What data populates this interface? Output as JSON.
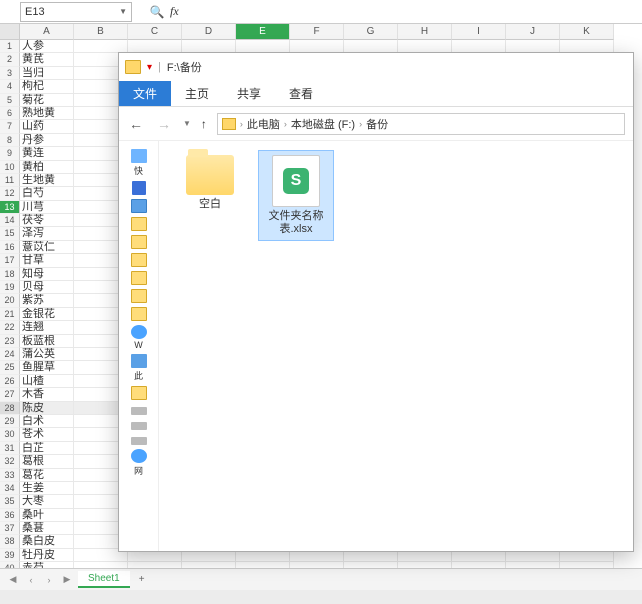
{
  "formula_bar": {
    "cell_ref": "E13",
    "fx_label": "fx",
    "value": ""
  },
  "columns": [
    "A",
    "B",
    "C",
    "D",
    "E",
    "F",
    "G",
    "H",
    "I",
    "J",
    "K"
  ],
  "active_col_index": 4,
  "active_row_index": 12,
  "hover_row_index": 27,
  "rows": [
    "人参",
    "黄芪",
    "当归",
    "枸杞",
    "菊花",
    "熟地黄",
    "山药",
    "丹参",
    "黄连",
    "黄柏",
    "生地黄",
    "白芍",
    "川芎",
    "茯苓",
    "泽泻",
    "薏苡仁",
    "甘草",
    "知母",
    "贝母",
    "紫苏",
    "金银花",
    "连翘",
    "板蓝根",
    "蒲公英",
    "鱼腥草",
    "山楂",
    "木香",
    "陈皮",
    "白术",
    "苍术",
    "白芷",
    "葛根",
    "葛花",
    "生姜",
    "大枣",
    "桑叶",
    "桑葚",
    "桑白皮",
    "牡丹皮",
    "赤芍"
  ],
  "sheet_tabs": {
    "active": "Sheet1",
    "add": "+"
  },
  "status_text": "",
  "explorer": {
    "title_path": "F:\\备份",
    "ribbon": {
      "file": "文件",
      "home": "主页",
      "share": "共享",
      "view": "查看"
    },
    "nav": {
      "back": "←",
      "fwd": "→",
      "up": "↑"
    },
    "breadcrumb": [
      "此电脑",
      "本地磁盘 (F:)",
      "备份"
    ],
    "sidebar": [
      {
        "ic": "ic-star",
        "label": "快"
      },
      {
        "ic": "ic-dl",
        "label": ""
      },
      {
        "ic": "ic-doc",
        "label": ""
      },
      {
        "ic": "ic-fold",
        "label": ""
      },
      {
        "ic": "ic-fold",
        "label": ""
      },
      {
        "ic": "ic-fold",
        "label": ""
      },
      {
        "ic": "ic-fold",
        "label": ""
      },
      {
        "ic": "ic-fold",
        "label": ""
      },
      {
        "ic": "ic-fold",
        "label": ""
      },
      {
        "ic": "ic-wps",
        "label": "W"
      },
      {
        "ic": "ic-pc",
        "label": "此"
      },
      {
        "ic": "ic-fold",
        "label": ""
      },
      {
        "ic": "ic-disk",
        "label": ""
      },
      {
        "ic": "ic-disk",
        "label": ""
      },
      {
        "ic": "ic-disk",
        "label": ""
      },
      {
        "ic": "ic-net",
        "label": "网"
      }
    ],
    "items": [
      {
        "type": "folder",
        "name": "空白",
        "selected": false
      },
      {
        "type": "file",
        "name": "文件夹名称表.xlsx",
        "selected": true,
        "badge": "S"
      }
    ]
  }
}
